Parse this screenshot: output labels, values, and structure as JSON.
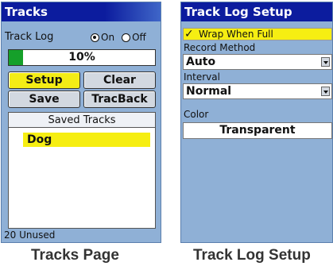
{
  "tracks_page": {
    "title": "Tracks",
    "track_log_label": "Track Log",
    "radio_on": "On",
    "radio_off": "Off",
    "selected_radio": "On",
    "progress": {
      "percent": 10,
      "text": "10%",
      "fill_color": "#15a02a"
    },
    "buttons": {
      "setup": "Setup",
      "clear": "Clear",
      "save": "Save",
      "tracback": "TracBack"
    },
    "saved_tracks_header": "Saved Tracks",
    "saved_tracks": [
      "Dog"
    ],
    "footer": "20 Unused"
  },
  "setup_page": {
    "title": "Track Log Setup",
    "wrap_checkbox": {
      "label": "Wrap When Full",
      "checked": true
    },
    "record_method": {
      "label": "Record Method",
      "value": "Auto"
    },
    "interval": {
      "label": "Interval",
      "value": "Normal"
    },
    "color": {
      "label": "Color",
      "value": "Transparent"
    }
  },
  "captions": {
    "left": "Tracks Page",
    "right": "Track Log Setup"
  },
  "theme": {
    "title_bar": "#0c1c9e",
    "background": "#8fb0d6",
    "highlight": "#f6ee12"
  }
}
